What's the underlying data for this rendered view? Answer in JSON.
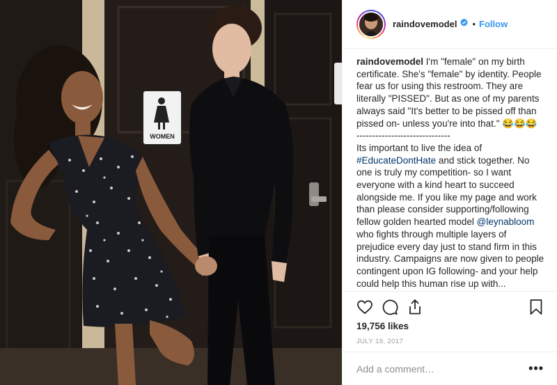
{
  "post": {
    "image": {
      "sign_label": "WOMEN",
      "alt_subject": "two-people-by-restroom-door"
    },
    "header": {
      "username": "raindovemodel",
      "verified": true,
      "separator": "•",
      "follow_label": "Follow"
    },
    "caption": {
      "username": "raindovemodel",
      "text_1": " I'm \"female\" on my birth certificate. She's \"female\" by identity. People fear us for using this restroom. They are literally \"PISSED\". But as one of my parents always said \"It's better to be pissed off than pissed on- unless you're into that.\" 😂😂😂",
      "divider": "------------------------------",
      "text_2a": "Its important to live the idea of ",
      "hashtag": "#EducateDontHate",
      "text_2b": " and stick together. No one is truly my competition- so I want everyone with a kind heart to succeed alongside me. If you like my page and work than please consider supporting/following fellow golden hearted model ",
      "mention": "@leynabloom",
      "text_2c": " who fights through multiple layers of prejudice every day just to stand firm in this industry. Campaigns are now given to people contingent upon IG following- and your help could help this human rise up with..."
    },
    "actions": {
      "like_icon": "heart-icon",
      "comment_icon": "comment-icon",
      "share_icon": "share-icon",
      "save_icon": "bookmark-icon",
      "likes": "19,756 likes",
      "date": "JULY 19, 2017"
    },
    "comment": {
      "placeholder": "Add a comment…",
      "more_label": "•••"
    },
    "colors": {
      "link": "#3897f0",
      "caption_link": "#003569",
      "verified": "#3897f0",
      "muted": "#999999"
    }
  }
}
